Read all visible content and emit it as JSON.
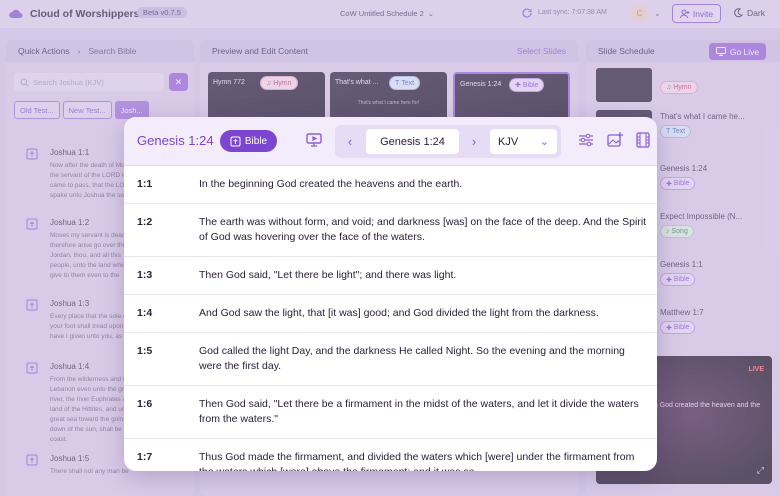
{
  "app": {
    "title": "Cloud of Worshippers",
    "beta": "Beta v0.7.5",
    "schedule_title": "CoW Untitled Schedule 2",
    "sync": "Last sync: 7:07:38 AM",
    "avatar_initial": "C",
    "invite": "Invite",
    "theme": "Dark"
  },
  "left": {
    "tab_active": "Quick Actions",
    "tab_other": "Search Bible",
    "search_placeholder": "Search Joshua (KJV)",
    "filters": [
      "Old Test...",
      "New Test...",
      "Josh..."
    ],
    "items": [
      {
        "ref": "Joshua 1:1",
        "text": "Now after the death of Moses the servant of the LORD it came to pass, that the LORD spake unto Joshua the son of Nun Moses' minister..."
      },
      {
        "ref": "Joshua 1:2",
        "text": "Moses my servant is dead; now therefore arise go over this Jordan, thou, and all this people, unto the land which I do give to them even to the children of Israel."
      },
      {
        "ref": "Joshua 1:3",
        "text": "Every place that the sole of your foot shall tread upon that have I given unto you, as I said unto Moses."
      },
      {
        "ref": "Joshua 1:4",
        "text": "From the wilderness and this Lebanon even unto the great river, the river Euphrates all the land of the Hittites, and unto the great sea toward the going down of the sun, shall be your coast."
      },
      {
        "ref": "Joshua 1:5",
        "text": "There shall not any man be able to"
      }
    ]
  },
  "middle": {
    "title": "Preview and Edit Content",
    "select_link": "Select Slides",
    "thumbs": [
      {
        "title": "Hymn 772",
        "tag": "Hymn",
        "sub": ""
      },
      {
        "title": "That's what ...",
        "tag": "Text",
        "sub": "That's what I came here for!"
      },
      {
        "title": "Genesis 1:24",
        "tag": "Bible",
        "sub": ""
      }
    ]
  },
  "right": {
    "title": "Slide Schedule",
    "go_live": "Go Live",
    "items": [
      {
        "title": "",
        "tag": "Hymn"
      },
      {
        "title": "That's what I came he...",
        "tag": "Text"
      },
      {
        "title": "Genesis 1:24",
        "tag": "Bible"
      },
      {
        "title": "Expect Impossible (N...",
        "tag": "Song"
      },
      {
        "title": "Genesis 1:1",
        "tag": "Bible"
      },
      {
        "title": "Matthew 1:7",
        "tag": "Bible"
      }
    ],
    "live_badge": "LIVE",
    "live_text": "In the beginning God created the heaven and the"
  },
  "modal": {
    "title": "Genesis 1:24",
    "badge": "Bible",
    "reference": "Genesis 1:24",
    "version": "KJV",
    "verses": [
      {
        "num": "1:1",
        "text": "In the beginning God created the heavens and the earth."
      },
      {
        "num": "1:2",
        "text": "The earth was without form, and void; and darkness [was] on the face of the deep. And the Spirit of God was hovering over the face of the waters."
      },
      {
        "num": "1:3",
        "text": "Then God said, \"Let there be light\"; and there was light."
      },
      {
        "num": "1:4",
        "text": "And God saw the light, that [it was] good; and God divided the light from the darkness."
      },
      {
        "num": "1:5",
        "text": "God called the light Day, and the darkness He called Night. So the evening and the morning were the first day."
      },
      {
        "num": "1:6",
        "text": "Then God said, \"Let there be a firmament in the midst of the waters, and let it divide the waters from the waters.\""
      },
      {
        "num": "1:7",
        "text": "Thus God made the firmament, and divided the waters which [were] under the firmament from the waters which [were] above the firmament; and it was so."
      }
    ]
  }
}
